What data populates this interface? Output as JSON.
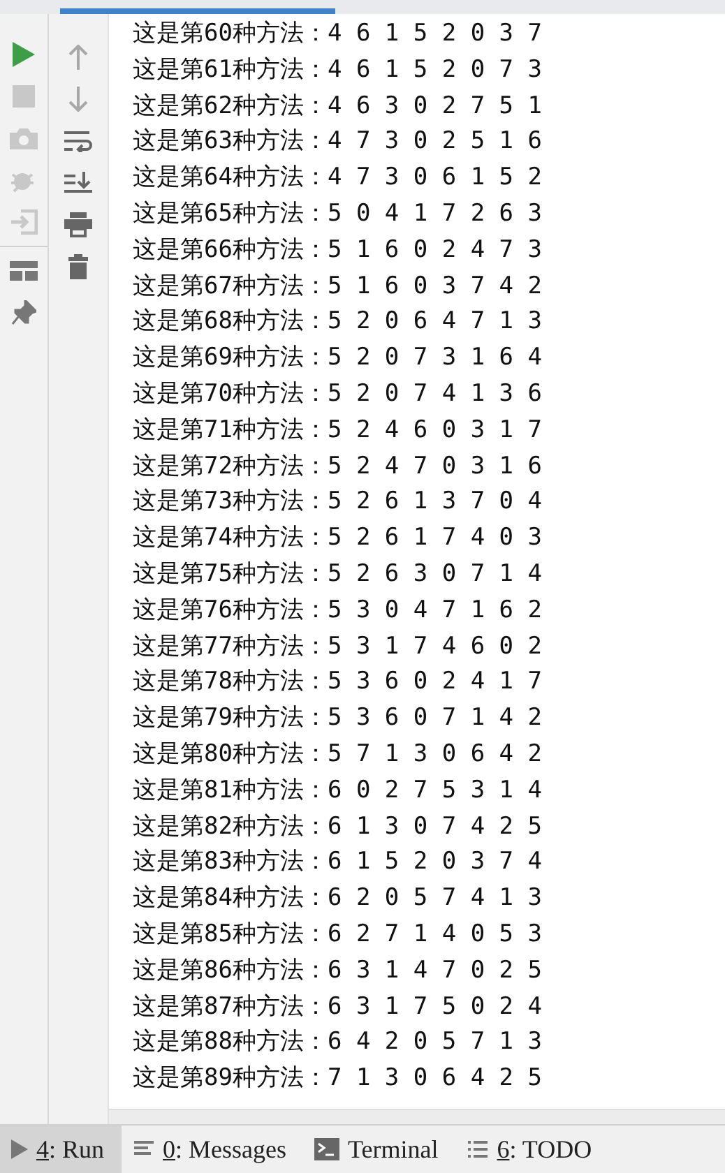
{
  "console": {
    "lines": [
      "这是第60种方法：4 6 1 5 2 0 3 7",
      "这是第61种方法：4 6 1 5 2 0 7 3",
      "这是第62种方法：4 6 3 0 2 7 5 1",
      "这是第63种方法：4 7 3 0 2 5 1 6",
      "这是第64种方法：4 7 3 0 6 1 5 2",
      "这是第65种方法：5 0 4 1 7 2 6 3",
      "这是第66种方法：5 1 6 0 2 4 7 3",
      "这是第67种方法：5 1 6 0 3 7 4 2",
      "这是第68种方法：5 2 0 6 4 7 1 3",
      "这是第69种方法：5 2 0 7 3 1 6 4",
      "这是第70种方法：5 2 0 7 4 1 3 6",
      "这是第71种方法：5 2 4 6 0 3 1 7",
      "这是第72种方法：5 2 4 7 0 3 1 6",
      "这是第73种方法：5 2 6 1 3 7 0 4",
      "这是第74种方法：5 2 6 1 7 4 0 3",
      "这是第75种方法：5 2 6 3 0 7 1 4",
      "这是第76种方法：5 3 0 4 7 1 6 2",
      "这是第77种方法：5 3 1 7 4 6 0 2",
      "这是第78种方法：5 3 6 0 2 4 1 7",
      "这是第79种方法：5 3 6 0 7 1 4 2",
      "这是第80种方法：5 7 1 3 0 6 4 2",
      "这是第81种方法：6 0 2 7 5 3 1 4",
      "这是第82种方法：6 1 3 0 7 4 2 5",
      "这是第83种方法：6 1 5 2 0 3 7 4",
      "这是第84种方法：6 2 0 5 7 4 1 3",
      "这是第85种方法：6 2 7 1 4 0 5 3",
      "这是第86种方法：6 3 1 4 7 0 2 5",
      "这是第87种方法：6 3 1 7 5 0 2 4",
      "这是第88种方法：6 4 2 0 5 7 1 3",
      "这是第89种方法：7 1 3 0 6 4 2 5"
    ]
  },
  "tool_tabs": [
    {
      "kind": "run",
      "mnemonic": "4",
      "label": ": Run",
      "selected": true
    },
    {
      "kind": "messages",
      "mnemonic": "0",
      "label": ": Messages",
      "selected": false
    },
    {
      "kind": "terminal",
      "label": "Terminal",
      "selected": false
    },
    {
      "kind": "todo",
      "mnemonic": "6",
      "label": ": TODO",
      "selected": false
    }
  ]
}
